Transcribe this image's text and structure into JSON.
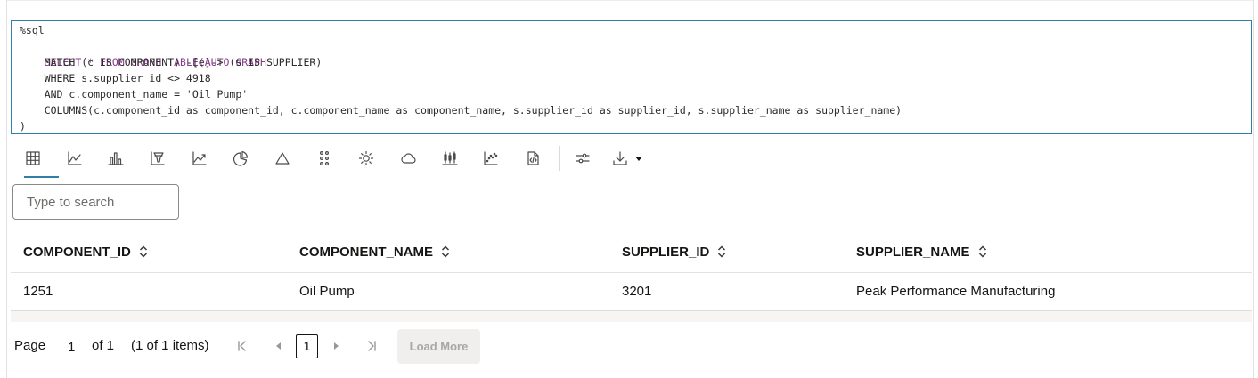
{
  "editor": {
    "lines": [
      "%sql",
      "SELECT * FROM GRAPH_TABLE(AUTO_GRAPH",
      "    MATCH (c IS COMPONENT) -[e]-> (s IS SUPPLIER)",
      "    WHERE s.supplier_id <> 4918",
      "    AND c.component_name = 'Oil Pump'",
      "    COLUMNS(c.component_id as component_id, c.component_name as component_name, s.supplier_id as supplier_id, s.supplier_name as supplier_name)",
      ")"
    ]
  },
  "toolbar": {
    "buttons": [
      "table-icon",
      "line-chart-icon",
      "bar-chart-icon",
      "funnel-chart-icon",
      "area-chart-icon",
      "pie-chart-icon",
      "pyramid-chart-icon",
      "matrix-icon",
      "sunburst-icon",
      "tag-cloud-icon",
      "box-plot-icon",
      "scatter-plot-icon",
      "code-file-icon"
    ],
    "settings_icon": "sliders-icon",
    "download_icon": "download-icon",
    "active": "table-icon",
    "accent_color": "#2f7fa6"
  },
  "search": {
    "placeholder": "Type to search",
    "value": ""
  },
  "table": {
    "columns": [
      "COMPONENT_ID",
      "COMPONENT_NAME",
      "SUPPLIER_ID",
      "SUPPLIER_NAME"
    ],
    "rows": [
      [
        "1251",
        "Oil Pump",
        "3201",
        "Peak Performance Manufacturing"
      ]
    ]
  },
  "pagination": {
    "page_label": "Page",
    "page_value": "1",
    "of_label": "of 1",
    "items_label": "(1 of 1 items)",
    "current_page": "1",
    "load_more_label": "Load More"
  }
}
